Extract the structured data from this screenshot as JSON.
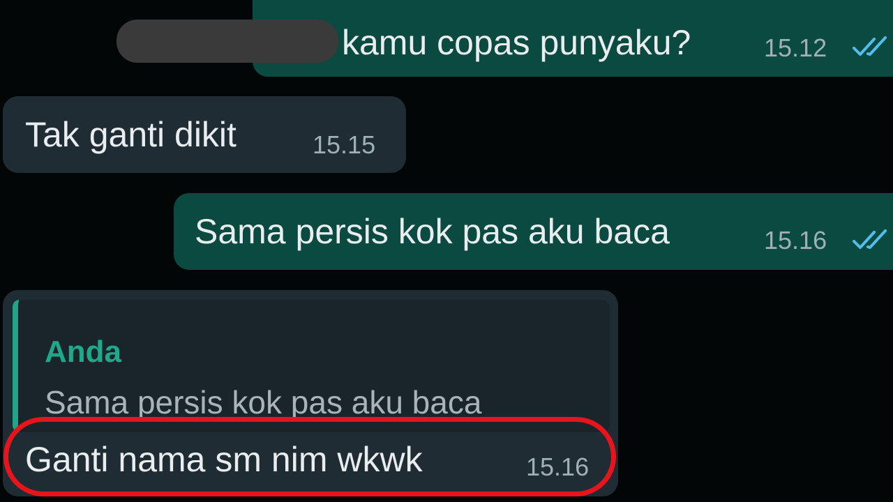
{
  "messages": [
    {
      "direction": "outgoing",
      "text": "kamu copas punyaku?",
      "time": "15.12",
      "status": "read-ticks-icon"
    },
    {
      "direction": "incoming",
      "text": "Tak ganti dikit",
      "time": "15.15"
    },
    {
      "direction": "outgoing",
      "text": "Sama persis kok pas aku baca",
      "time": "15.16",
      "status": "read-ticks-icon"
    },
    {
      "direction": "incoming",
      "reply_to": {
        "author": "Anda",
        "text": "Sama persis kok pas aku baca"
      },
      "text": "Ganti nama sm nim wkwk",
      "time": "15.16"
    }
  ],
  "colors": {
    "background": "#030607",
    "outgoing_bubble": "#0b4a40",
    "incoming_bubble": "#1f2c33",
    "read_ticks": "#53bdeb",
    "quote_accent": "#21a58a",
    "highlight_ring": "#e8141c"
  }
}
